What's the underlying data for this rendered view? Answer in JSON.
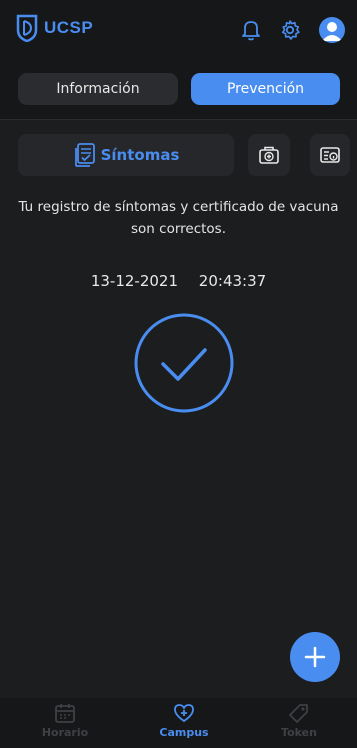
{
  "app": {
    "name": "UCSP"
  },
  "header": {
    "icons": [
      "bell-icon",
      "gear-icon",
      "user-avatar-icon"
    ]
  },
  "tabs": [
    {
      "label": "Información",
      "active": false
    },
    {
      "label": "Prevención",
      "active": true
    }
  ],
  "actions": {
    "sintomas_label": "Síntomas",
    "sintomas_icon": "checklist-icon",
    "cert_icon": "medical-bag-icon",
    "info_icon": "info-card-icon"
  },
  "status": {
    "message": "Tu registro de síntomas y certificado de vacuna son correctos.",
    "date": "13-12-2021",
    "time": "20:43:37",
    "icon": "checkmark-circle-icon"
  },
  "fab": {
    "icon": "plus-icon"
  },
  "bottom_nav": [
    {
      "label": "Horario",
      "icon": "calendar-icon",
      "active": false
    },
    {
      "label": "Campus",
      "icon": "heart-shield-icon",
      "active": true
    },
    {
      "label": "Token",
      "icon": "tag-icon",
      "active": false
    }
  ],
  "colors": {
    "accent": "#4a8df0",
    "background": "#1c1d1f",
    "surface": "#26272a",
    "inactive": "#3e4045"
  }
}
